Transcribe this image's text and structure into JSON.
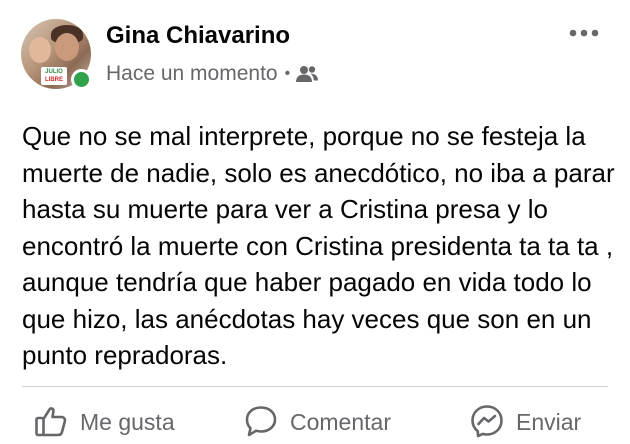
{
  "post": {
    "author": {
      "name": "Gina Chiavarino",
      "avatar_badge_line1": "JULIO",
      "avatar_badge_line2": "LIBRE",
      "online_status_color": "#31a24c"
    },
    "timestamp": "Hace un momento",
    "separator": "•",
    "audience_icon": "friends-icon",
    "more_icon": "more-options-icon",
    "text": "Que no se mal interprete, porque no se festeja la muerte de nadie, solo es anecdótico, no iba a parar hasta su muerte para ver a Cristina presa y lo encontró la muerte con Cristina presidenta ta ta ta , aunque tendría que haber pagado en vida todo lo que hizo, las anécdotas hay veces que son en un punto repradoras."
  },
  "actions": {
    "like": {
      "label": "Me gusta",
      "icon": "thumbs-up-icon"
    },
    "comment": {
      "label": "Comentar",
      "icon": "comment-bubble-icon"
    },
    "send": {
      "label": "Enviar",
      "icon": "messenger-icon"
    }
  },
  "colors": {
    "text_primary": "#050505",
    "text_secondary": "#65676b",
    "divider": "#ced0d4"
  }
}
